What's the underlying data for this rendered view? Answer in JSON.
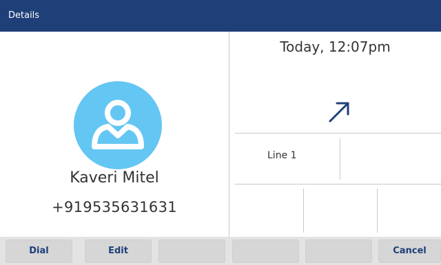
{
  "header": {
    "title": "Details"
  },
  "contact": {
    "name": "Kaveri Mitel",
    "number": "+919535631631",
    "avatar_color": "#63c6f3",
    "avatar_icon": "person-icon"
  },
  "call": {
    "time": "Today, 12:07pm",
    "direction_icon": "outgoing-call-arrow-icon",
    "line_label": "Line 1"
  },
  "softkeys": [
    "Dial",
    "Edit",
    "",
    "",
    "",
    "Cancel"
  ],
  "colors": {
    "titlebar": "#1f3f78",
    "accent": "#1f3f78",
    "softkey_bar": "#e3e3e3",
    "softkey": "#d6d6d6"
  }
}
